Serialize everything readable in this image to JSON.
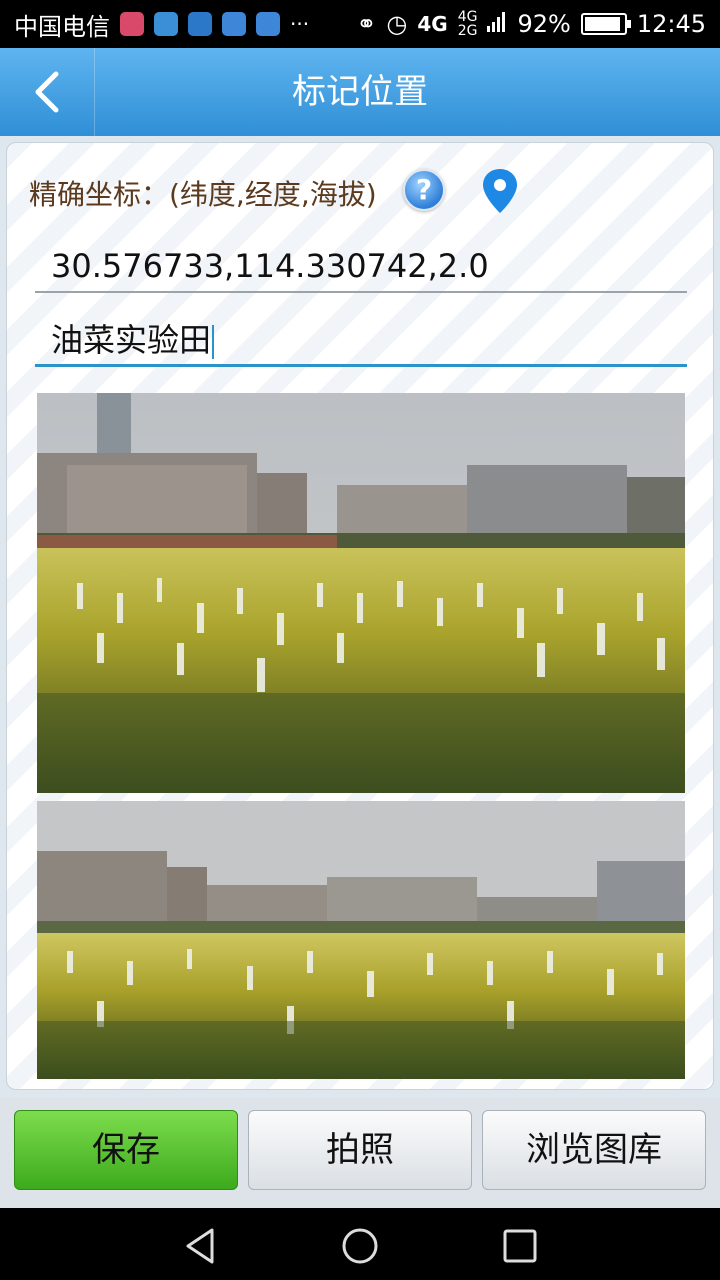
{
  "status_bar": {
    "carrier": "中国电信",
    "network_main": "4G",
    "network_top": "4G",
    "network_bottom": "2G",
    "battery": "92%",
    "battery_level": 0.92,
    "time": "12:45",
    "more": "···"
  },
  "header": {
    "title": "标记位置",
    "back_icon": "chevron-left-icon"
  },
  "form": {
    "coord_label": "精确坐标：(纬度,经度,海拔)",
    "help_icon": "question-icon",
    "location_icon": "map-pin-icon",
    "coords_value": "30.576733,114.330742,2.0",
    "name_value": "油菜实验田"
  },
  "buttons": {
    "save": "保存",
    "take_photo": "拍照",
    "browse_gallery": "浏览图库"
  },
  "nav": {
    "back": "triangle-back-icon",
    "home": "circle-home-icon",
    "recents": "square-recents-icon"
  },
  "colors": {
    "title_bar": "#3d9be0",
    "save_button": "#4cbb22",
    "accent": "#2a93c8"
  }
}
